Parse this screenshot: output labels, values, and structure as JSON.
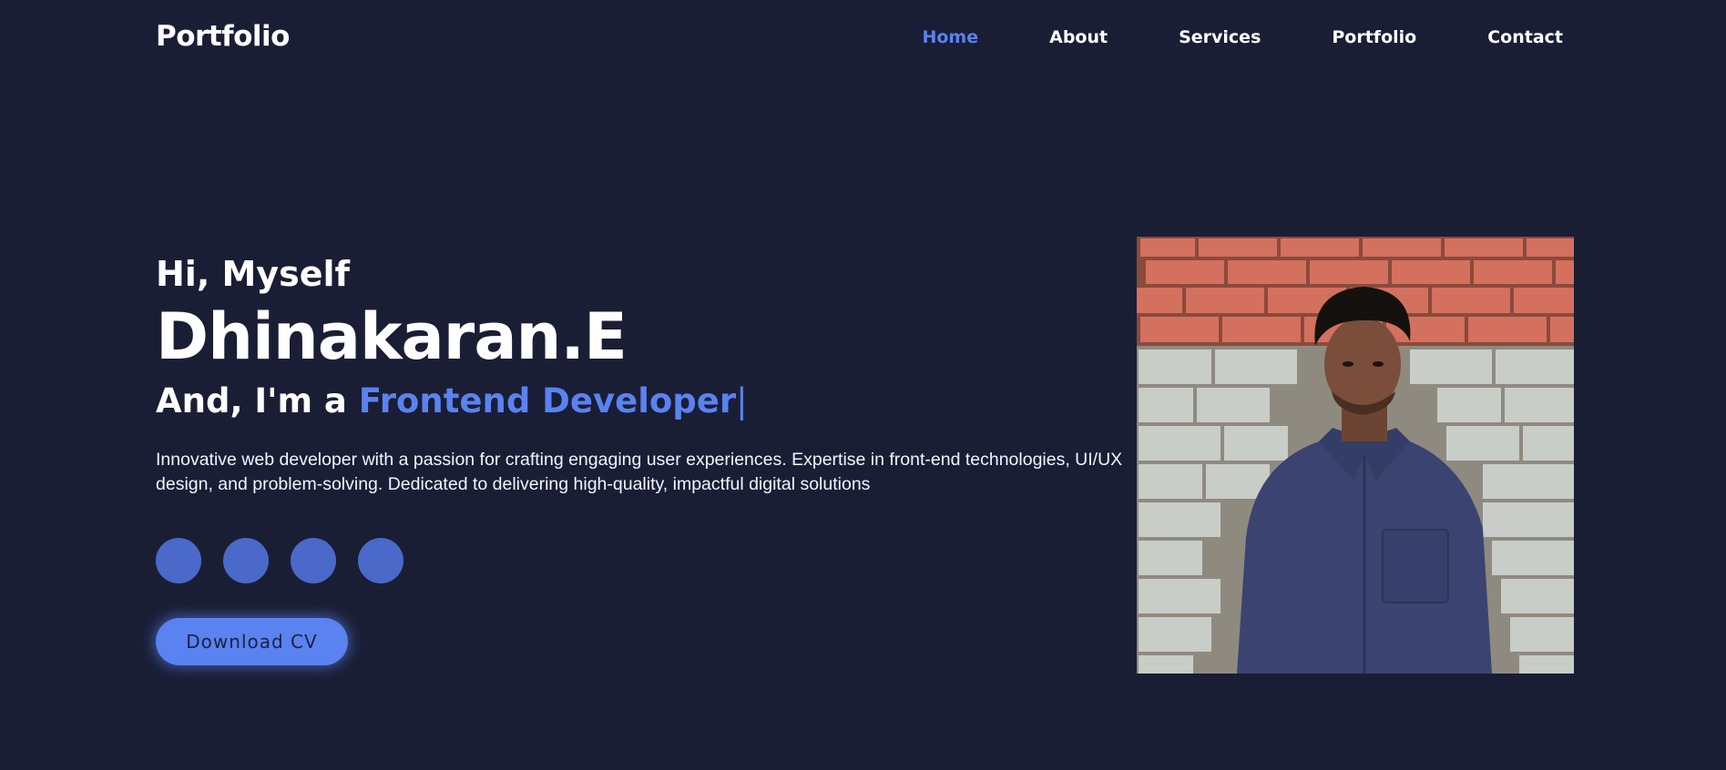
{
  "header": {
    "logo": "Portfolio",
    "nav": [
      {
        "label": "Home",
        "active": true
      },
      {
        "label": "About",
        "active": false
      },
      {
        "label": "Services",
        "active": false
      },
      {
        "label": "Portfolio",
        "active": false
      },
      {
        "label": "Contact",
        "active": false
      }
    ]
  },
  "hero": {
    "greeting": "Hi, Myself",
    "name": "Dhinakaran.E",
    "role_prefix": "And, I'm a ",
    "role_highlight": "Frontend Developer",
    "cursor": "|",
    "description": "Innovative web developer with a passion for crafting engaging user experiences. Expertise in front-end technologies, UI/UX design, and problem-solving. Dedicated to delivering high-quality, impactful digital solutions",
    "socials": [
      "social-icon-1",
      "social-icon-2",
      "social-icon-3",
      "social-icon-4"
    ],
    "cv_button": "Download CV"
  },
  "colors": {
    "background": "#1a1e35",
    "accent": "#5a82f0",
    "social": "#4a69c8"
  }
}
